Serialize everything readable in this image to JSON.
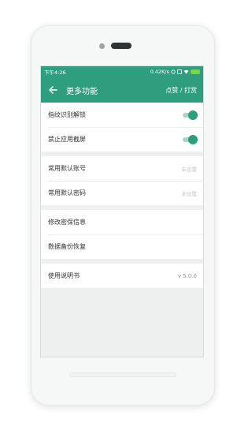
{
  "status_bar": {
    "time": "下午4:26",
    "network": "0.42K/s"
  },
  "header": {
    "title": "更多功能",
    "action": "点赞 / 打赏"
  },
  "settings": {
    "fingerprint_unlock": {
      "label": "指纹识别解锁",
      "enabled": true
    },
    "block_screenshot": {
      "label": "禁止应用截屏",
      "enabled": true
    },
    "default_account": {
      "label": "常用默认账号",
      "value": "未设置"
    },
    "default_password": {
      "label": "常用默认密码",
      "value": "未设置"
    },
    "security_info": {
      "label": "修改密保信息"
    },
    "data_backup": {
      "label": "数据备份恢复"
    },
    "manual": {
      "label": "使用说明书",
      "value": "v 5.0.0"
    }
  },
  "colors": {
    "accent": "#2f9e7f",
    "background": "#eef0f0"
  }
}
